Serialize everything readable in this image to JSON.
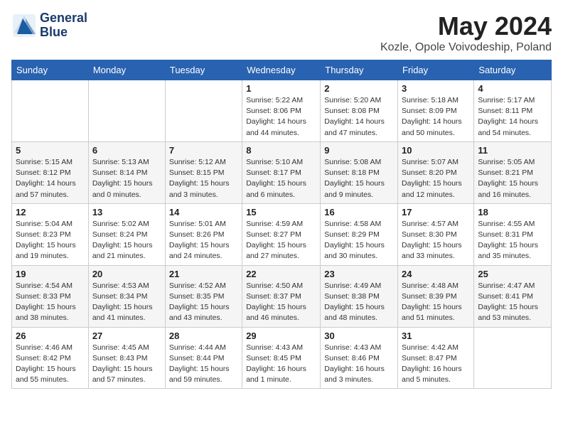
{
  "header": {
    "logo_line1": "General",
    "logo_line2": "Blue",
    "month_year": "May 2024",
    "location": "Kozle, Opole Voivodeship, Poland"
  },
  "weekdays": [
    "Sunday",
    "Monday",
    "Tuesday",
    "Wednesday",
    "Thursday",
    "Friday",
    "Saturday"
  ],
  "weeks": [
    [
      {
        "day": "",
        "info": ""
      },
      {
        "day": "",
        "info": ""
      },
      {
        "day": "",
        "info": ""
      },
      {
        "day": "1",
        "info": "Sunrise: 5:22 AM\nSunset: 8:06 PM\nDaylight: 14 hours\nand 44 minutes."
      },
      {
        "day": "2",
        "info": "Sunrise: 5:20 AM\nSunset: 8:08 PM\nDaylight: 14 hours\nand 47 minutes."
      },
      {
        "day": "3",
        "info": "Sunrise: 5:18 AM\nSunset: 8:09 PM\nDaylight: 14 hours\nand 50 minutes."
      },
      {
        "day": "4",
        "info": "Sunrise: 5:17 AM\nSunset: 8:11 PM\nDaylight: 14 hours\nand 54 minutes."
      }
    ],
    [
      {
        "day": "5",
        "info": "Sunrise: 5:15 AM\nSunset: 8:12 PM\nDaylight: 14 hours\nand 57 minutes."
      },
      {
        "day": "6",
        "info": "Sunrise: 5:13 AM\nSunset: 8:14 PM\nDaylight: 15 hours\nand 0 minutes."
      },
      {
        "day": "7",
        "info": "Sunrise: 5:12 AM\nSunset: 8:15 PM\nDaylight: 15 hours\nand 3 minutes."
      },
      {
        "day": "8",
        "info": "Sunrise: 5:10 AM\nSunset: 8:17 PM\nDaylight: 15 hours\nand 6 minutes."
      },
      {
        "day": "9",
        "info": "Sunrise: 5:08 AM\nSunset: 8:18 PM\nDaylight: 15 hours\nand 9 minutes."
      },
      {
        "day": "10",
        "info": "Sunrise: 5:07 AM\nSunset: 8:20 PM\nDaylight: 15 hours\nand 12 minutes."
      },
      {
        "day": "11",
        "info": "Sunrise: 5:05 AM\nSunset: 8:21 PM\nDaylight: 15 hours\nand 16 minutes."
      }
    ],
    [
      {
        "day": "12",
        "info": "Sunrise: 5:04 AM\nSunset: 8:23 PM\nDaylight: 15 hours\nand 19 minutes."
      },
      {
        "day": "13",
        "info": "Sunrise: 5:02 AM\nSunset: 8:24 PM\nDaylight: 15 hours\nand 21 minutes."
      },
      {
        "day": "14",
        "info": "Sunrise: 5:01 AM\nSunset: 8:26 PM\nDaylight: 15 hours\nand 24 minutes."
      },
      {
        "day": "15",
        "info": "Sunrise: 4:59 AM\nSunset: 8:27 PM\nDaylight: 15 hours\nand 27 minutes."
      },
      {
        "day": "16",
        "info": "Sunrise: 4:58 AM\nSunset: 8:29 PM\nDaylight: 15 hours\nand 30 minutes."
      },
      {
        "day": "17",
        "info": "Sunrise: 4:57 AM\nSunset: 8:30 PM\nDaylight: 15 hours\nand 33 minutes."
      },
      {
        "day": "18",
        "info": "Sunrise: 4:55 AM\nSunset: 8:31 PM\nDaylight: 15 hours\nand 35 minutes."
      }
    ],
    [
      {
        "day": "19",
        "info": "Sunrise: 4:54 AM\nSunset: 8:33 PM\nDaylight: 15 hours\nand 38 minutes."
      },
      {
        "day": "20",
        "info": "Sunrise: 4:53 AM\nSunset: 8:34 PM\nDaylight: 15 hours\nand 41 minutes."
      },
      {
        "day": "21",
        "info": "Sunrise: 4:52 AM\nSunset: 8:35 PM\nDaylight: 15 hours\nand 43 minutes."
      },
      {
        "day": "22",
        "info": "Sunrise: 4:50 AM\nSunset: 8:37 PM\nDaylight: 15 hours\nand 46 minutes."
      },
      {
        "day": "23",
        "info": "Sunrise: 4:49 AM\nSunset: 8:38 PM\nDaylight: 15 hours\nand 48 minutes."
      },
      {
        "day": "24",
        "info": "Sunrise: 4:48 AM\nSunset: 8:39 PM\nDaylight: 15 hours\nand 51 minutes."
      },
      {
        "day": "25",
        "info": "Sunrise: 4:47 AM\nSunset: 8:41 PM\nDaylight: 15 hours\nand 53 minutes."
      }
    ],
    [
      {
        "day": "26",
        "info": "Sunrise: 4:46 AM\nSunset: 8:42 PM\nDaylight: 15 hours\nand 55 minutes."
      },
      {
        "day": "27",
        "info": "Sunrise: 4:45 AM\nSunset: 8:43 PM\nDaylight: 15 hours\nand 57 minutes."
      },
      {
        "day": "28",
        "info": "Sunrise: 4:44 AM\nSunset: 8:44 PM\nDaylight: 15 hours\nand 59 minutes."
      },
      {
        "day": "29",
        "info": "Sunrise: 4:43 AM\nSunset: 8:45 PM\nDaylight: 16 hours\nand 1 minute."
      },
      {
        "day": "30",
        "info": "Sunrise: 4:43 AM\nSunset: 8:46 PM\nDaylight: 16 hours\nand 3 minutes."
      },
      {
        "day": "31",
        "info": "Sunrise: 4:42 AM\nSunset: 8:47 PM\nDaylight: 16 hours\nand 5 minutes."
      },
      {
        "day": "",
        "info": ""
      }
    ]
  ]
}
